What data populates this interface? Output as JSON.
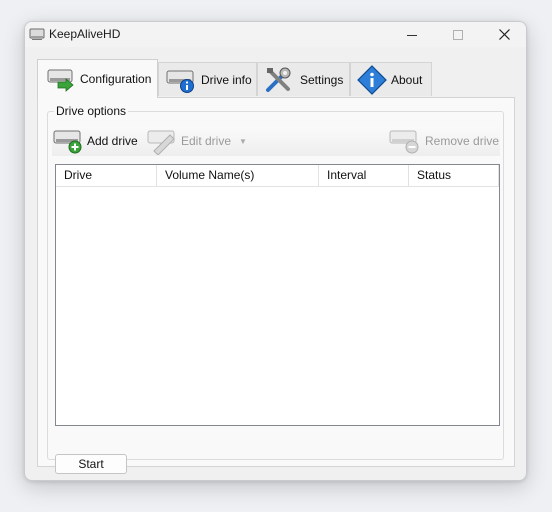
{
  "window": {
    "title": "KeepAliveHD",
    "controls": {
      "minimize_icon": "minimize-icon",
      "maximize_icon": "maximize-icon",
      "close_icon": "close-icon"
    }
  },
  "tabs": [
    {
      "label": "Configuration",
      "icon": "drive-arrow-icon",
      "active": true
    },
    {
      "label": "Drive info",
      "icon": "drive-info-icon",
      "active": false
    },
    {
      "label": "Settings",
      "icon": "tools-icon",
      "active": false
    },
    {
      "label": "About",
      "icon": "info-diamond-icon",
      "active": false
    }
  ],
  "drive_options": {
    "legend": "Drive options",
    "toolbar": {
      "add": {
        "label": "Add drive",
        "enabled": true
      },
      "edit": {
        "label": "Edit drive",
        "enabled": false
      },
      "remove": {
        "label": "Remove drive",
        "enabled": false
      }
    },
    "columns": [
      "Drive",
      "Volume Name(s)",
      "Interval",
      "Status"
    ],
    "rows": []
  },
  "start_button": {
    "label": "Start"
  }
}
